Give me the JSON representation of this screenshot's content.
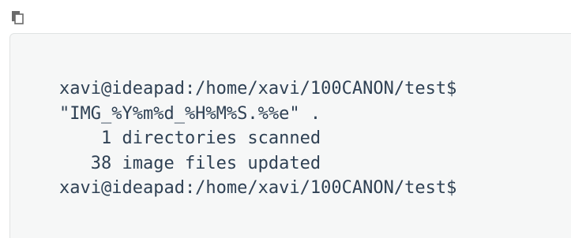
{
  "toolbar": {
    "copy_icon": "copy-icon"
  },
  "terminal": {
    "lines": [
      "xavi@ideapad:/home/xavi/100CANON/test$",
      "\"IMG_%Y%m%d_%H%M%S.%%e\" .",
      "    1 directories scanned",
      "   38 image files updated",
      "xavi@ideapad:/home/xavi/100CANON/test$"
    ]
  },
  "colors": {
    "code_background": "#f6f7f7",
    "code_text": "#2f4154",
    "icon": "#6b6b6b"
  }
}
